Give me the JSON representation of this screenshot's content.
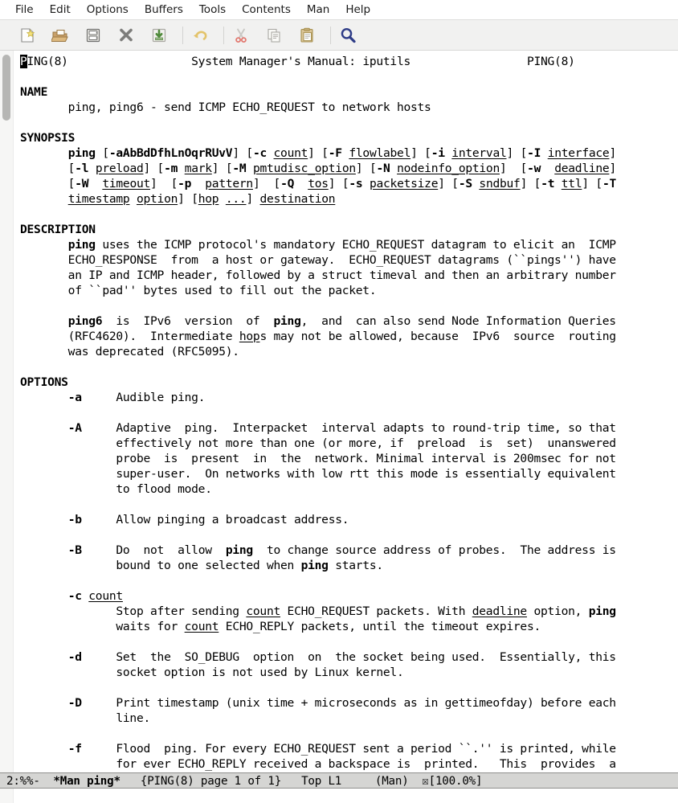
{
  "window": {
    "title": "*Man ping*"
  },
  "menubar": {
    "items": [
      {
        "label": "File",
        "name": "menu-file"
      },
      {
        "label": "Edit",
        "name": "menu-edit"
      },
      {
        "label": "Options",
        "name": "menu-options"
      },
      {
        "label": "Buffers",
        "name": "menu-buffers"
      },
      {
        "label": "Tools",
        "name": "menu-tools"
      },
      {
        "label": "Contents",
        "name": "menu-contents"
      },
      {
        "label": "Man",
        "name": "menu-man"
      },
      {
        "label": "Help",
        "name": "menu-help"
      }
    ]
  },
  "toolbar": {
    "buttons": [
      {
        "icon": "new-file-icon",
        "tooltip": "New file"
      },
      {
        "icon": "open-file-icon",
        "tooltip": "Open file"
      },
      {
        "icon": "save-icon",
        "tooltip": "Save buffer"
      },
      {
        "icon": "close-icon",
        "tooltip": "Close buffer"
      },
      {
        "icon": "save-as-icon",
        "tooltip": "Write file"
      },
      {
        "icon": "separator",
        "tooltip": ""
      },
      {
        "icon": "undo-icon",
        "tooltip": "Undo"
      },
      {
        "icon": "separator",
        "tooltip": ""
      },
      {
        "icon": "cut-icon",
        "tooltip": "Cut"
      },
      {
        "icon": "copy-icon",
        "tooltip": "Copy"
      },
      {
        "icon": "paste-icon",
        "tooltip": "Paste"
      },
      {
        "icon": "separator",
        "tooltip": ""
      },
      {
        "icon": "search-icon",
        "tooltip": "Search"
      }
    ]
  },
  "scrollbar": {
    "thumb_top_pct": 0.6,
    "thumb_height_pct": 9.2
  },
  "manpage": {
    "header_left": "PING(8)",
    "header_center": "System Manager's Manual: iputils",
    "header_right": "PING(8)",
    "cursor_char": "P",
    "sections": [
      "NAME",
      "SYNOPSIS",
      "DESCRIPTION",
      "OPTIONS"
    ],
    "name_body": "ping, ping6 - send ICMP ECHO_REQUEST to network hosts",
    "synopsis_lines": [
      "ping [-aAbBdDfhLnOqrRUvV] [-c count] [-F flowlabel] [-i interval] [-I interface]",
      "[-l preload] [-m mark] [-M pmtudisc_option] [-N nodeinfo_option]  [-w  deadline]",
      "[-W  timeout]  [-p  pattern]  [-Q  tos] [-s packetsize] [-S sndbuf] [-t ttl] [-T",
      "timestamp option] [hop ...] destination"
    ],
    "description_paragraphs": [
      "ping uses the ICMP protocol's mandatory ECHO_REQUEST datagram to elicit an  ICMP ECHO_RESPONSE  from  a host or gateway.  ECHO_REQUEST datagrams (``pings'') have an IP and ICMP header, followed by a struct timeval and then an arbitrary number of ``pad'' bytes used to fill out the packet.",
      "ping6  is  IPv6  version  of  ping,  and  can also send Node Information Queries (RFC4620).  Intermediate hops may not be allowed, because  IPv6  source  routing was deprecated (RFC5095)."
    ],
    "options": [
      {
        "flag": "-a",
        "arg": "",
        "body": "Audible ping."
      },
      {
        "flag": "-A",
        "arg": "",
        "body": "Adaptive  ping.  Interpacket  interval adapts to round-trip time, so that effectively not more than one (or more, if  preload  is  set)  unanswered probe  is  present  in  the  network. Minimal interval is 200msec for not super-user.  On networks with low rtt this mode is essentially equivalent to flood mode."
      },
      {
        "flag": "-b",
        "arg": "",
        "body": "Allow pinging a broadcast address."
      },
      {
        "flag": "-B",
        "arg": "",
        "body": "Do  not  allow  ping  to change source address of probes.  The address is bound to one selected when ping starts."
      },
      {
        "flag": "-c",
        "arg": "count",
        "body": "Stop after sending count ECHO_REQUEST packets. With deadline option, ping waits for count ECHO_REPLY packets, until the timeout expires."
      },
      {
        "flag": "-d",
        "arg": "",
        "body": "Set  the  SO_DEBUG  option  on  the socket being used.  Essentially, this socket option is not used by Linux kernel."
      },
      {
        "flag": "-D",
        "arg": "",
        "body": "Print timestamp (unix time + microseconds as in gettimeofday) before each line."
      },
      {
        "flag": "-f",
        "arg": "",
        "body": "Flood  ping. For every ECHO_REQUEST sent a period ``.'' is printed, while for ever ECHO_REPLY received a backspace is  printed.   This  provides  a"
      }
    ]
  },
  "modeline": {
    "coding": "2:%%-",
    "buffer_name": "*Man ping*",
    "page_info": "{PING(8) page 1 of 1}",
    "position": "Top L1",
    "major_mode": "(Man)",
    "mail_icon": "☒",
    "percent": "[100.0%]"
  },
  "minibuffer": {
    "text": ""
  },
  "colors": {
    "menubar_bg": "#ffffff",
    "toolbar_bg": "#f1f1f0",
    "text_bg": "#ffffff",
    "text_fg": "#000000",
    "modeline_bg": "#d5d5d3",
    "scrollbar_thumb": "#b6b6b4"
  }
}
